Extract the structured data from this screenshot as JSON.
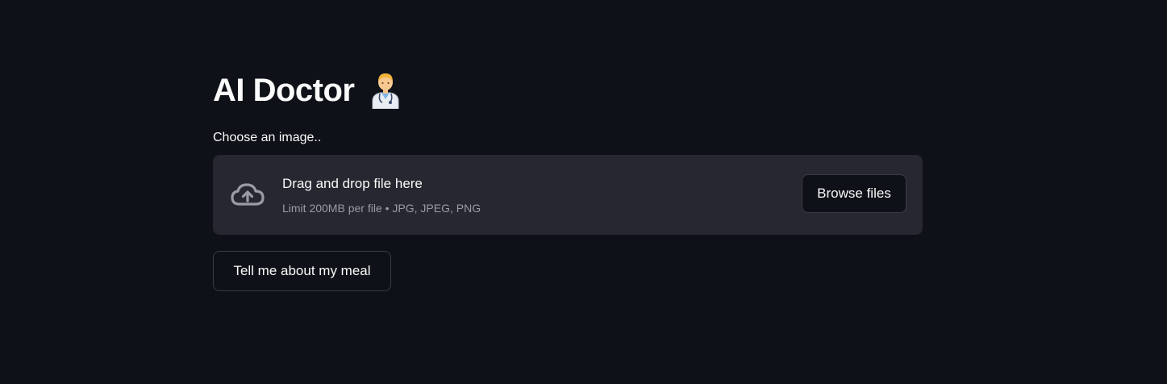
{
  "header": {
    "title": "AI Doctor",
    "title_icon": "doctor-emoji-icon"
  },
  "uploader": {
    "label": "Choose an image..",
    "drop_text": "Drag and drop file here",
    "limit_text": "Limit 200MB per file • JPG, JPEG, PNG",
    "browse_label": "Browse files",
    "icon": "cloud-upload-icon"
  },
  "actions": {
    "submit_label": "Tell me about my meal"
  },
  "colors": {
    "background": "#0e1117",
    "dropzone": "#262730",
    "text": "#fafafa",
    "muted_text": "#9a9ba3",
    "border": "#3a3c45"
  }
}
